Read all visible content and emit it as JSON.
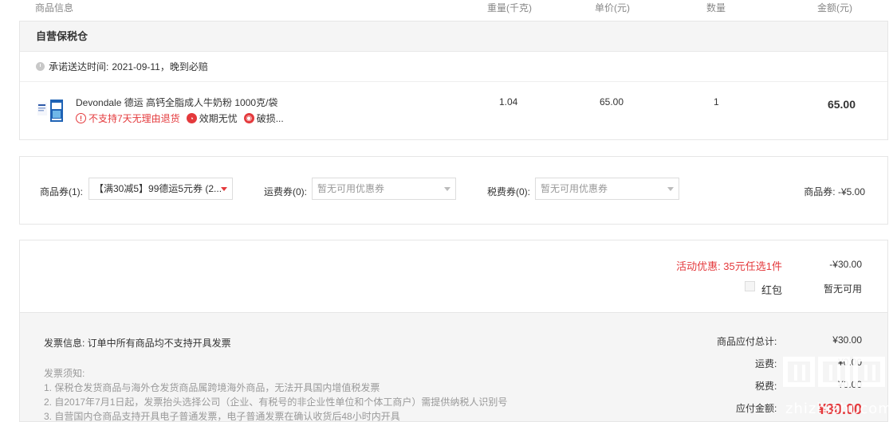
{
  "header": {
    "product_info": "商品信息",
    "weight": "重量(千克)",
    "unit_price": "单价(元)",
    "quantity": "数量",
    "amount": "金额(元)"
  },
  "store": {
    "title": "自营保税仓",
    "promise_label": "承诺送达时间:",
    "promise_date": "2021-09-11",
    "promise_note": "，晚到必赔",
    "item": {
      "name": "Devondale 德运 高钙全脂成人牛奶粉 1000克/袋",
      "weight": "1.04",
      "unit_price": "65.00",
      "quantity": "1",
      "total": "65.00",
      "tags": [
        "不支持7天无理由退货",
        "效期无忧",
        "破损..."
      ]
    }
  },
  "coupons": {
    "goods_label": "商品券(1):",
    "goods_selected": "【满30减5】99德运5元券 (2...",
    "shipping_label": "运费券(0):",
    "shipping_selected": "暂无可用优惠券",
    "tax_label": "税费券(0):",
    "tax_selected": "暂无可用优惠券",
    "summary": "商品券: -¥5.00"
  },
  "promo": {
    "label": "活动优惠: 35元任选1件",
    "value": "-¥30.00",
    "red_packet_label": "红包",
    "red_packet_value": "暂无可用"
  },
  "invoice": {
    "info": "发票信息: 订单中所有商品均不支持开具发票",
    "notes_title": "发票须知:",
    "notes": [
      "1. 保税仓发货商品与海外仓发货商品属跨境海外商品，无法开具国内增值税发票",
      "2. 自2017年7月1日起，发票抬头选择公司（企业、有税号的非企业性单位和个体工商户）需提供纳税人识别号",
      "3. 自营国内仓商品支持开具电子普通发票，电子普通发票在确认收货后48小时内开具"
    ]
  },
  "summary": {
    "goods_total_label": "商品应付总计:",
    "goods_total": "¥30.00",
    "shipping_label": "运费:",
    "shipping": "¥0.00",
    "tax_label": "税费:",
    "tax": "¥0.00",
    "payable_label": "应付金额:",
    "payable": "¥30.00"
  },
  "watermark": {
    "text": "zhizhizhi.com"
  },
  "colors": {
    "accent": "#e4393c",
    "muted": "#999999",
    "panel": "#f5f5f5"
  }
}
